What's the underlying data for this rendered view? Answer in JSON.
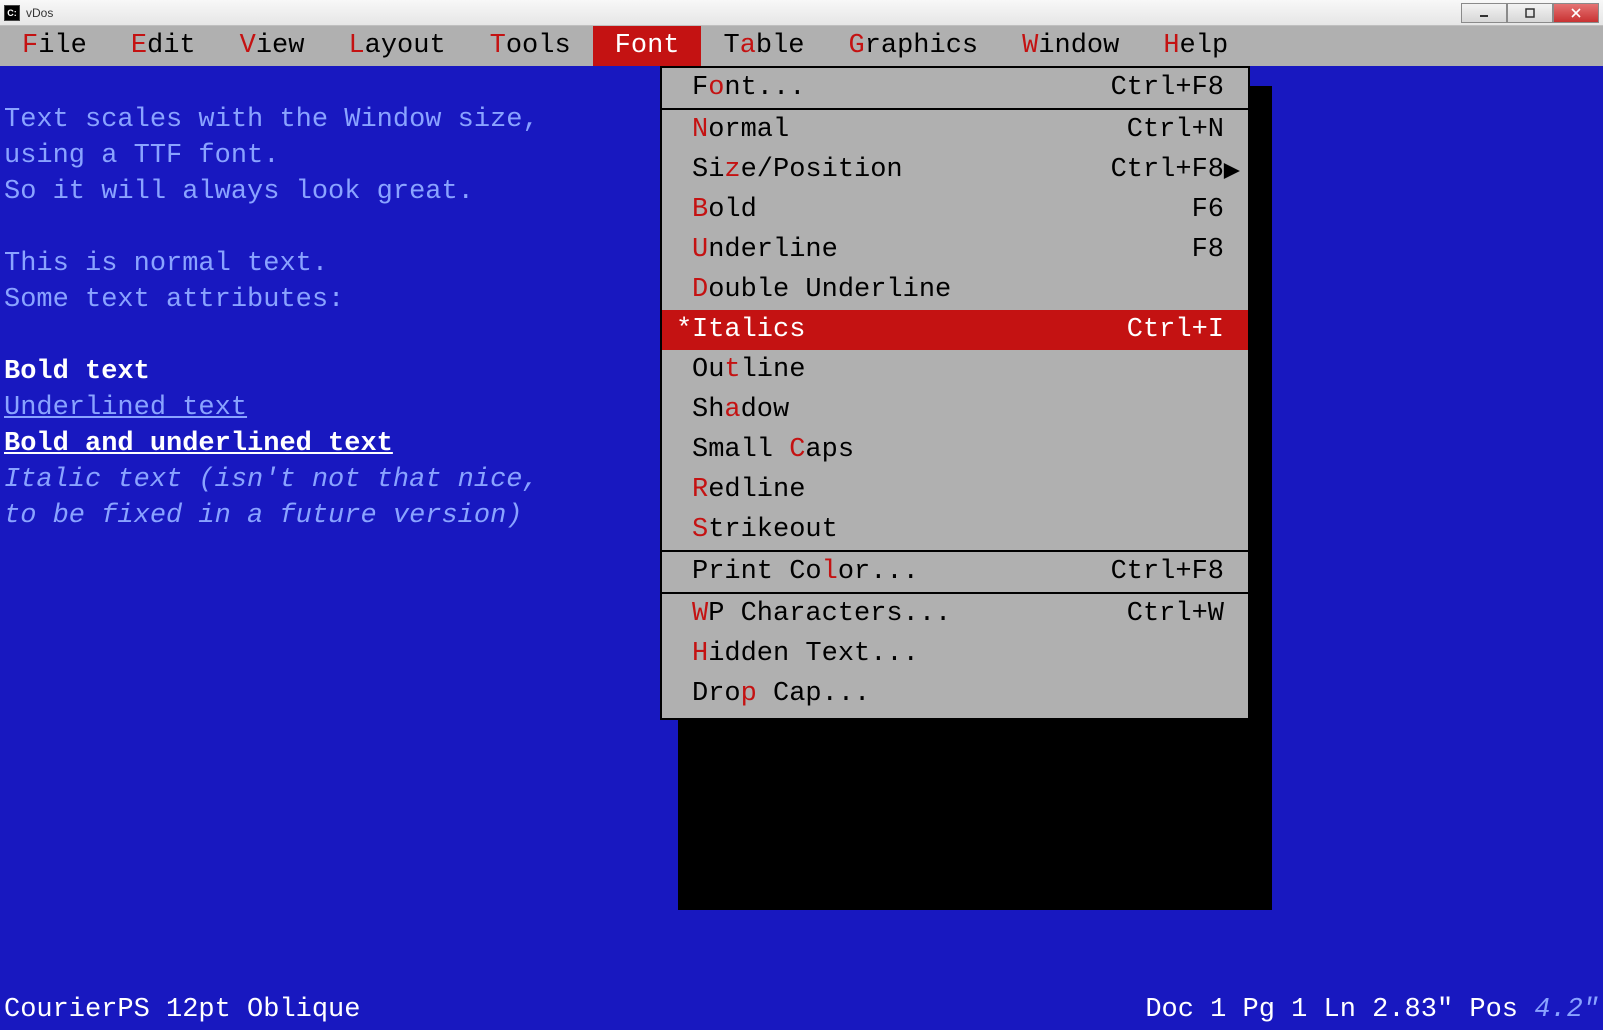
{
  "window": {
    "title": "vDos"
  },
  "menubar": {
    "items": [
      {
        "pre": "",
        "hot": "F",
        "post": "ile"
      },
      {
        "pre": "",
        "hot": "E",
        "post": "dit"
      },
      {
        "pre": "",
        "hot": "V",
        "post": "iew"
      },
      {
        "pre": "",
        "hot": "L",
        "post": "ayout"
      },
      {
        "pre": "",
        "hot": "T",
        "post": "ools"
      },
      {
        "pre": "F",
        "hot": "o",
        "post": "nt",
        "active": true
      },
      {
        "pre": "T",
        "hot": "a",
        "post": "ble"
      },
      {
        "pre": "",
        "hot": "G",
        "post": "raphics"
      },
      {
        "pre": "",
        "hot": "W",
        "post": "indow"
      },
      {
        "pre": "",
        "hot": "H",
        "post": "elp"
      }
    ]
  },
  "editor": {
    "line1": "Text scales with the Window size,",
    "line2": "using a TTF font.",
    "line3": "So it will always look great.",
    "line5": "This is normal text.",
    "line6": "Some text attributes:",
    "bold": "Bold text",
    "underlined": "Underlined text",
    "boldul": "Bold and underlined text",
    "italic1": "Italic text (isn't not that nice,",
    "italic2": "to be fixed in a future version)"
  },
  "dropdown": {
    "groups": [
      [
        {
          "pre": "F",
          "hot": "o",
          "post": "nt...",
          "shortcut": "Ctrl+F8"
        }
      ],
      [
        {
          "pre": "",
          "hot": "N",
          "post": "ormal",
          "shortcut": "Ctrl+N"
        },
        {
          "pre": "Si",
          "hot": "z",
          "post": "e/Position",
          "shortcut": "Ctrl+F8",
          "submenu": true
        },
        {
          "pre": "",
          "hot": "B",
          "post": "old",
          "shortcut": "F6"
        },
        {
          "pre": "",
          "hot": "U",
          "post": "nderline",
          "shortcut": "F8"
        },
        {
          "pre": "",
          "hot": "D",
          "post": "ouble Underline",
          "shortcut": ""
        },
        {
          "pre": "",
          "hot": "I",
          "post": "talics",
          "shortcut": "Ctrl+I",
          "selected": true,
          "checked": true
        },
        {
          "pre": "Ou",
          "hot": "t",
          "post": "line",
          "shortcut": ""
        },
        {
          "pre": "Sh",
          "hot": "a",
          "post": "dow",
          "shortcut": ""
        },
        {
          "pre": "Small ",
          "hot": "C",
          "post": "aps",
          "shortcut": ""
        },
        {
          "pre": "",
          "hot": "R",
          "post": "edline",
          "shortcut": ""
        },
        {
          "pre": "",
          "hot": "S",
          "post": "trikeout",
          "shortcut": ""
        }
      ],
      [
        {
          "pre": "Print Co",
          "hot": "l",
          "post": "or...",
          "shortcut": "Ctrl+F8"
        }
      ],
      [
        {
          "pre": "",
          "hot": "W",
          "post": "P Characters...",
          "shortcut": "Ctrl+W"
        },
        {
          "pre": "",
          "hot": "H",
          "post": "idden Text...",
          "shortcut": ""
        },
        {
          "pre": "Dro",
          "hot": "p",
          "post": " Cap...",
          "shortcut": ""
        }
      ]
    ]
  },
  "status": {
    "left": "CourierPS 12pt Oblique",
    "doc": "Doc 1 Pg 1 Ln 2.83\" Pos ",
    "pos": "4.2\""
  }
}
